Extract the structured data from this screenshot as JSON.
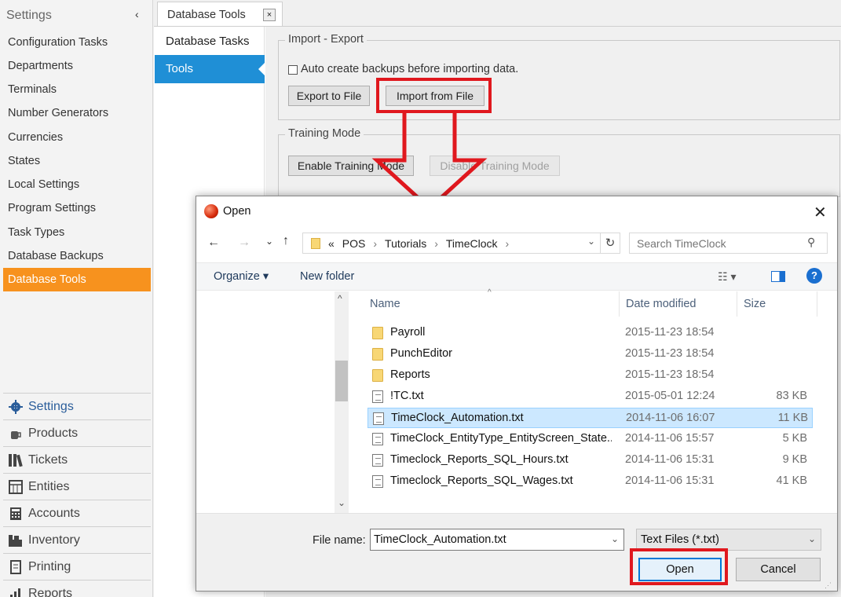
{
  "settings_panel": {
    "header": "Settings",
    "items": [
      {
        "label": "Configuration Tasks"
      },
      {
        "label": "Departments"
      },
      {
        "label": "Terminals"
      },
      {
        "label": "Number Generators"
      },
      {
        "label": "Currencies"
      },
      {
        "label": "States"
      },
      {
        "label": "Local Settings"
      },
      {
        "label": "Program Settings"
      },
      {
        "label": "Task Types"
      },
      {
        "label": "Database Backups"
      },
      {
        "label": "Database Tools",
        "active": true
      }
    ]
  },
  "main_nav": [
    {
      "label": "Settings",
      "icon": "gear-icon"
    },
    {
      "label": "Products",
      "icon": "coffee-icon"
    },
    {
      "label": "Tickets",
      "icon": "tickets-icon"
    },
    {
      "label": "Entities",
      "icon": "grid-icon"
    },
    {
      "label": "Accounts",
      "icon": "calculator-icon"
    },
    {
      "label": "Inventory",
      "icon": "inventory-icon"
    },
    {
      "label": "Printing",
      "icon": "printing-icon"
    },
    {
      "label": "Reports",
      "icon": "reports-icon"
    }
  ],
  "document_tab": {
    "label": "Database Tools",
    "close": "×"
  },
  "db_nav": {
    "item1": "Database Tasks",
    "item2": "Tools"
  },
  "import_export": {
    "legend": "Import - Export",
    "auto_backup_label": "Auto create backups before importing data.",
    "export_button": "Export to File",
    "import_button": "Import from File"
  },
  "training_mode": {
    "legend": "Training Mode",
    "enable_button": "Enable Training Mode",
    "disable_button": "Disable Training Mode"
  },
  "dialog": {
    "title": "Open",
    "address": {
      "overflow": "«",
      "crumbs": [
        "POS",
        "Tutorials",
        "TimeClock"
      ]
    },
    "search_placeholder": "Search TimeClock",
    "toolbar": {
      "organize": "Organize",
      "new_folder": "New folder"
    },
    "columns": {
      "name": "Name",
      "date": "Date modified",
      "size": "Size"
    },
    "files": [
      {
        "name": "Payroll",
        "date": "2015-11-23 18:54",
        "size": "",
        "type": "folder"
      },
      {
        "name": "PunchEditor",
        "date": "2015-11-23 18:54",
        "size": "",
        "type": "folder"
      },
      {
        "name": "Reports",
        "date": "2015-11-23 18:54",
        "size": "",
        "type": "folder"
      },
      {
        "name": "!TC.txt",
        "date": "2015-05-01 12:24",
        "size": "83 KB",
        "type": "file"
      },
      {
        "name": "TimeClock_Automation.txt",
        "date": "2014-11-06 16:07",
        "size": "11 KB",
        "type": "file",
        "selected": true
      },
      {
        "name": "TimeClock_EntityType_EntityScreen_State...",
        "date": "2014-11-06 15:57",
        "size": "5 KB",
        "type": "file"
      },
      {
        "name": "Timeclock_Reports_SQL_Hours.txt",
        "date": "2014-11-06 15:31",
        "size": "9 KB",
        "type": "file"
      },
      {
        "name": "Timeclock_Reports_SQL_Wages.txt",
        "date": "2014-11-06 15:31",
        "size": "41 KB",
        "type": "file"
      }
    ],
    "file_name_label": "File name:",
    "file_name_value": "TimeClock_Automation.txt",
    "file_type": "Text Files (*.txt)",
    "open_button": "Open",
    "cancel_button": "Cancel"
  },
  "colors": {
    "accent_orange": "#f7921e",
    "accent_blue": "#1f8fd6",
    "highlight_red": "#e0181e",
    "selection": "#cce8ff"
  }
}
